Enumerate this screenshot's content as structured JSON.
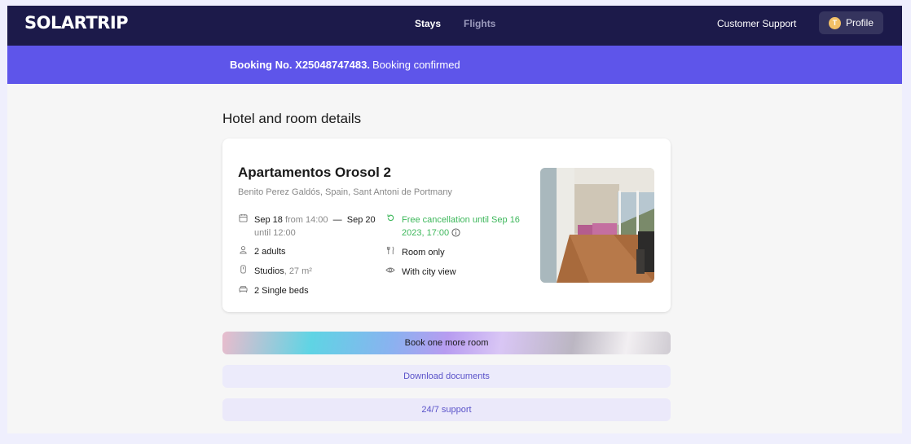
{
  "header": {
    "logo": "SOLARTRIP",
    "nav": [
      {
        "label": "Stays",
        "active": true
      },
      {
        "label": "Flights",
        "active": false
      }
    ],
    "support_label": "Customer Support",
    "profile": {
      "initial": "T",
      "label": "Profile"
    }
  },
  "banner": {
    "booking_number": "Booking No. X25048747483.",
    "status": "Booking confirmed"
  },
  "section_title": "Hotel and room details",
  "hotel": {
    "name": "Apartamentos Orosol 2",
    "address": "Benito Perez Galdós, Spain, Sant Antoni de Portmany",
    "checkin": {
      "date": "Sep 18",
      "time": "from 14:00"
    },
    "checkout": {
      "date": "Sep 20",
      "time": "until 12:00"
    },
    "dash": "—",
    "guests": "2 adults",
    "room_type": "Studios",
    "room_size": ", 27 m²",
    "beds": "2 Single beds",
    "cancellation": "Free cancellation until Sep 16 2023, 17:00",
    "meal": "Room only",
    "view": "With city view",
    "icons": [
      "calendar-icon",
      "refresh-icon",
      "info-icon",
      "person-icon",
      "fork-knife-icon",
      "door-icon",
      "eye-icon",
      "bed-icon"
    ]
  },
  "buttons": {
    "book_more": "Book one more room",
    "download": "Download documents",
    "support": "24/7 support"
  },
  "colors": {
    "topbar": "#1c1a4a",
    "banner": "#5e55ea",
    "accent_text": "#5a53c9",
    "success": "#3cb75a"
  }
}
